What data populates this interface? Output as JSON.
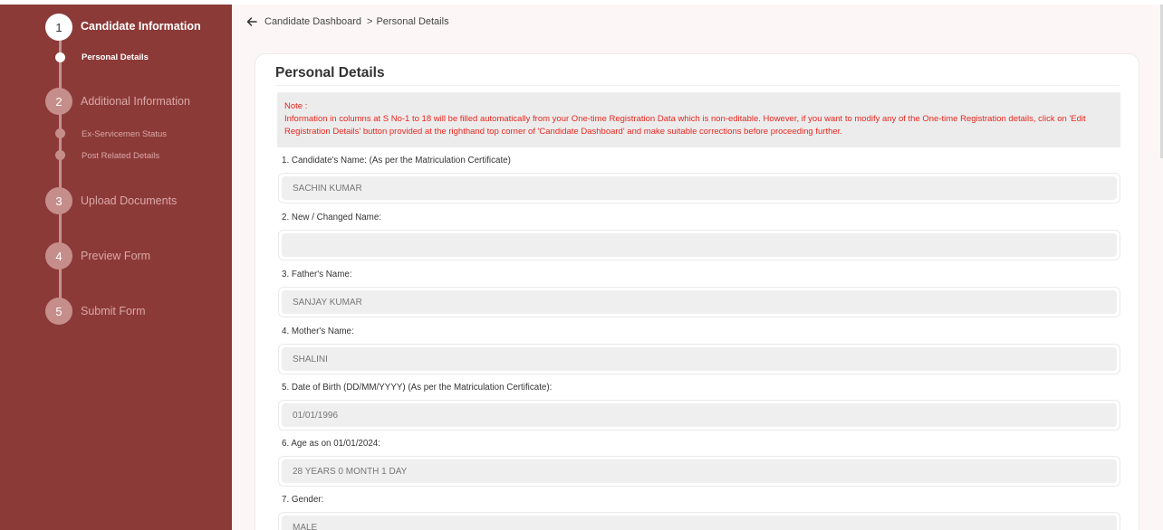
{
  "sidebar": {
    "steps": [
      {
        "number": "1",
        "label": "Candidate Information",
        "active": true
      },
      {
        "number": "2",
        "label": "Additional Information",
        "active": false
      },
      {
        "number": "3",
        "label": "Upload Documents",
        "active": false
      },
      {
        "number": "4",
        "label": "Preview Form",
        "active": false
      },
      {
        "number": "5",
        "label": "Submit Form",
        "active": false
      }
    ],
    "substeps": {
      "personal_details": "Personal Details",
      "ex_servicemen": "Ex-Servicemen Status",
      "post_related": "Post Related Details"
    }
  },
  "breadcrumb": {
    "dashboard": "Candidate Dashboard",
    "separator": ">",
    "current": "Personal Details"
  },
  "form": {
    "title": "Personal Details",
    "note_heading": "Note :",
    "note_text": "Information in columns at S No-1 to 18 will be filled automatically from your One-time Registration Data which is non-editable. However, if you want to modify any of the One-time Registration details, click on 'Edit Registration Details' button provided at the righthand top corner of 'Candidate Dashboard' and make suitable corrections before proceeding further.",
    "fields": [
      {
        "label": "1. Candidate's Name: (As per the Matriculation Certificate)",
        "value": "SACHIN KUMAR"
      },
      {
        "label": "2. New / Changed Name:",
        "value": ""
      },
      {
        "label": "3. Father's Name:",
        "value": "SANJAY KUMAR"
      },
      {
        "label": "4. Mother's Name:",
        "value": "SHALINI"
      },
      {
        "label": "5. Date of Birth (DD/MM/YYYY) (As per the Matriculation Certificate):",
        "value": "01/01/1996"
      },
      {
        "label": "6. Age as on 01/01/2024:",
        "value": "28 YEARS 0 MONTH 1 DAY"
      },
      {
        "label": "7. Gender:",
        "value": "MALE"
      }
    ]
  },
  "colors": {
    "sidebar_bg": "#8c3a38",
    "note_text": "#e8271f",
    "main_bg": "#fcf7f6"
  }
}
